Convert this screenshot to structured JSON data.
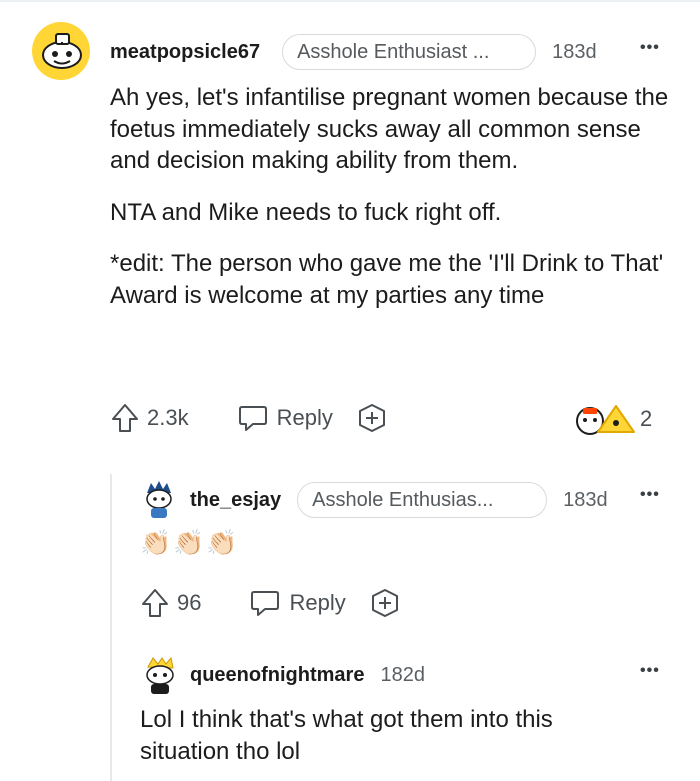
{
  "comments": [
    {
      "username": "meatpopsicle67",
      "flair": "Asshole Enthusiast ...",
      "age": "183d",
      "paragraphs": [
        "Ah yes, let's infantilise pregnant women because the foetus immediately sucks away all common sense and decision making ability from them.",
        "NTA and Mike needs to fuck right off.",
        "*edit: The person who gave me the 'I'll Drink to That' Award is welcome at my parties any time"
      ],
      "votes": "2.3k",
      "reply_label": "Reply",
      "award_count": "2"
    },
    {
      "username": "the_esjay",
      "flair": "Asshole Enthusias...",
      "age": "183d",
      "emoji": "👏🏻👏🏻👏🏻",
      "votes": "96",
      "reply_label": "Reply"
    },
    {
      "username": "queenofnightmare",
      "age": "182d",
      "text": "Lol I think that's what got them into this situation tho lol"
    }
  ],
  "more_label": "•••",
  "colors": {
    "avatar_yellow": "#ffd635",
    "text": "#1c1c1c",
    "muted": "#4a4f53",
    "border": "#d7dadc"
  },
  "icons": [
    "upvote-icon",
    "reply-bubble-icon",
    "add-award-icon",
    "award-icon",
    "more-icon",
    "avatar-icon"
  ]
}
